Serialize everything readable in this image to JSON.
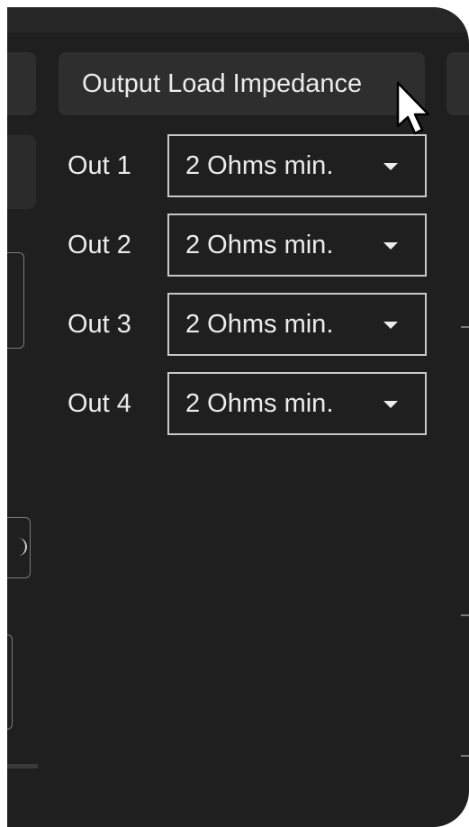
{
  "section": {
    "title": "Output Load Impedance"
  },
  "outputs": [
    {
      "label": "Out 1",
      "value": "2 Ohms min."
    },
    {
      "label": "Out 2",
      "value": "2 Ohms min."
    },
    {
      "label": "Out 3",
      "value": "2 Ohms min."
    },
    {
      "label": "Out 4",
      "value": "2 Ohms min."
    }
  ],
  "icons": {
    "dropdown": "chevron-down-icon",
    "cursor": "mouse-pointer-icon"
  },
  "colors": {
    "background": "#1f1f1f",
    "tab": "#2e2e2e",
    "text": "#ececec",
    "select_border": "#c8c8c8"
  }
}
